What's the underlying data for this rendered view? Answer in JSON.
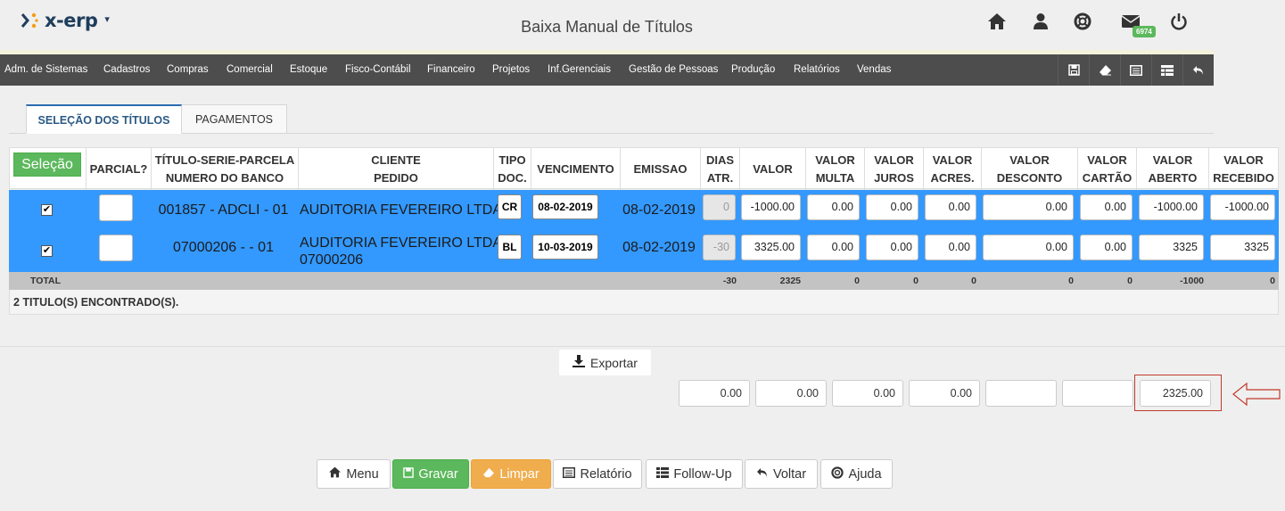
{
  "header": {
    "logo_text": "x-erp",
    "title": "Baixa Manual de Títulos",
    "mail_badge": "6974",
    "icons": [
      "home-icon",
      "user-icon",
      "lifebuoy-icon",
      "mail-icon",
      "power-icon"
    ]
  },
  "menu": {
    "items": [
      "Adm. de Sistemas",
      "Cadastros",
      "Compras",
      "Comercial",
      "Estoque",
      "Fisco-Contábil",
      "Financeiro",
      "Projetos",
      "Inf.Gerenciais",
      "Gestão de Pessoas",
      "Produção",
      "Relatórios",
      "Vendas"
    ],
    "tools": [
      "save-icon",
      "eraser-icon",
      "list-icon",
      "table-icon",
      "undo-icon"
    ]
  },
  "tabs": [
    {
      "label": "SELEÇÃO DOS TÍTULOS",
      "active": true
    },
    {
      "label": "PAGAMENTOS",
      "active": false
    }
  ],
  "grid": {
    "selection_button": "Seleção",
    "columns": {
      "parcial": "PARCIAL?",
      "titulo_1": "TÍTULO-SERIE-PARCELA",
      "titulo_2": "NUMERO DO BANCO",
      "cliente_1": "CLIENTE",
      "cliente_2": "PEDIDO",
      "tipo_1": "TIPO",
      "tipo_2": "DOC.",
      "vencimento": "VENCIMENTO",
      "emissao": "EMISSAO",
      "dias_1": "DIAS",
      "dias_2": "ATR.",
      "valor": "VALOR",
      "multa_1": "VALOR",
      "multa_2": "MULTA",
      "juros_1": "VALOR",
      "juros_2": "JUROS",
      "acres_1": "VALOR",
      "acres_2": "ACRES.",
      "desconto_1": "VALOR",
      "desconto_2": "DESCONTO",
      "cartao_1": "VALOR",
      "cartao_2": "CARTÃO",
      "aberto_1": "VALOR",
      "aberto_2": "ABERTO",
      "recebido_1": "VALOR",
      "recebido_2": "RECEBIDO"
    },
    "rows": [
      {
        "checked": "✔",
        "titulo": "001857 - ADCLI - 01",
        "cliente_1": "AUDITORIA FEVEREIRO LTDA",
        "cliente_2": "",
        "tipo": "CR",
        "vencimento": "08-02-2019",
        "emissao": "08-02-2019",
        "dias": "0",
        "valor": "-1000.00",
        "multa": "0.00",
        "juros": "0.00",
        "acres": "0.00",
        "desconto": "0.00",
        "cartao": "0.00",
        "aberto": "-1000.00",
        "recebido": "-1000.00"
      },
      {
        "checked": "✔",
        "titulo": "07000206 - - 01",
        "cliente_1": "AUDITORIA FEVEREIRO LTDA",
        "cliente_2": "07000206",
        "tipo": "BL",
        "vencimento": "10-03-2019",
        "emissao": "08-02-2019",
        "dias": "-30",
        "valor": "3325.00",
        "multa": "0.00",
        "juros": "0.00",
        "acres": "0.00",
        "desconto": "0.00",
        "cartao": "0.00",
        "aberto": "3325",
        "recebido": "3325"
      }
    ],
    "totals": {
      "label": "TOTAL",
      "dias": "-30",
      "valor": "2325",
      "multa": "0",
      "juros": "0",
      "acres": "0",
      "desconto": "0",
      "cartao": "0",
      "aberto": "-1000",
      "recebido": "0"
    },
    "found_text": "2 TITULO(S) ENCONTRADO(S)."
  },
  "export_label": "Exportar",
  "summary": [
    "0.00",
    "0.00",
    "0.00",
    "0.00",
    "",
    "",
    "2325.00"
  ],
  "buttons": {
    "menu": "Menu",
    "gravar": "Gravar",
    "limpar": "Limpar",
    "relatorio": "Relatório",
    "followup": "Follow-Up",
    "voltar": "Voltar",
    "ajuda": "Ajuda"
  },
  "colors": {
    "row_selected": "#3399ff",
    "menubar": "#4d4d4d",
    "green": "#5cb85c",
    "orange": "#f0ad4e",
    "highlight": "#c0392b"
  }
}
